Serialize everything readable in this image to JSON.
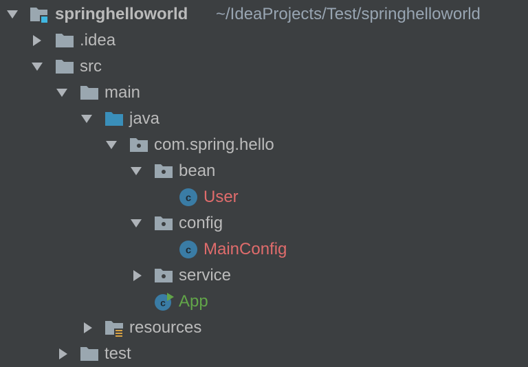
{
  "project": {
    "name": "springhelloworld",
    "path": "~/IdeaProjects/Test/springhelloworld"
  },
  "items": {
    "idea": "idea",
    "src": "src",
    "main": "main",
    "java": "java",
    "package": "com.spring.hello",
    "bean": "bean",
    "user": "User",
    "config": "config",
    "mainconfig": "MainConfig",
    "service": "service",
    "app": "App",
    "resources": "resources",
    "test": "test"
  },
  "colors": {
    "background": "#3c3f41",
    "text": "#bbbbbb",
    "modified_red": "#e06c6c",
    "added_green": "#62a549",
    "source_folder_blue": "#3a8fba",
    "class_icon_blue": "#3a7ca5"
  },
  "icons": {
    "expanded": "chevron-down-icon",
    "collapsed": "chevron-right-icon",
    "folder": "folder-icon",
    "package": "package-icon",
    "class": "class-icon",
    "runnable_class": "runnable-class-icon",
    "resources_folder": "resources-folder-icon",
    "module": "module-icon"
  }
}
